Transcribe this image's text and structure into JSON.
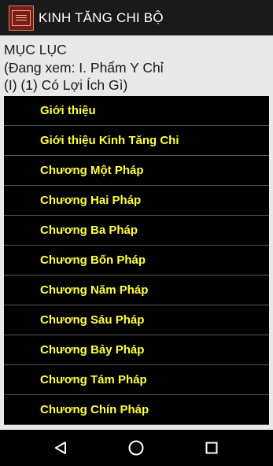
{
  "appbar": {
    "title": "KINH TĂNG CHI BỘ",
    "icon": "book-cover-icon"
  },
  "header": {
    "line1": "MỤC LỤC",
    "line2": "(Đang xem: I. Phẩm Y Chỉ",
    "line3": "(I) (1) Có Lợi Ích Gì)"
  },
  "menu": {
    "items": [
      {
        "label": "Giới thiệu"
      },
      {
        "label": "Giới thiệu Kinh Tăng Chi"
      },
      {
        "label": "Chương Một Pháp"
      },
      {
        "label": "Chương Hai Pháp"
      },
      {
        "label": "Chương Ba Pháp"
      },
      {
        "label": "Chương Bốn Pháp"
      },
      {
        "label": "Chương Năm Pháp"
      },
      {
        "label": "Chương Sáu Pháp"
      },
      {
        "label": "Chương Bảy Pháp"
      },
      {
        "label": "Chương Tám Pháp"
      },
      {
        "label": "Chương Chín Pháp"
      }
    ]
  },
  "navbar": {
    "back_icon": "back-triangle-icon",
    "home_icon": "home-circle-icon",
    "recents_icon": "recents-square-icon"
  },
  "colors": {
    "menu_text": "#ffff3a",
    "menu_bg": "#000000",
    "page_bg": "#e8e8e8"
  }
}
